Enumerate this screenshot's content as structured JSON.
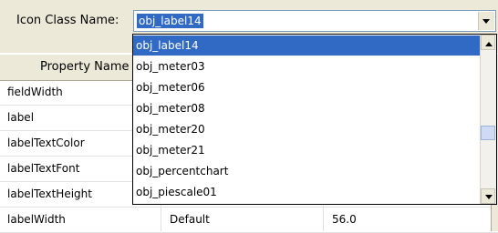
{
  "header": {
    "icon_class_label": "Icon Class Name:",
    "icon_class_value": "obj_label14"
  },
  "dropdown": {
    "items": [
      "obj_label14",
      "obj_meter03",
      "obj_meter06",
      "obj_meter08",
      "obj_meter20",
      "obj_meter21",
      "obj_percentchart",
      "obj_piescale01"
    ],
    "selected": "obj_label14"
  },
  "table": {
    "column_header": "Property Name",
    "rows": [
      {
        "name": "fieldWidth",
        "source": "",
        "value": ""
      },
      {
        "name": "label",
        "source": "",
        "value": ""
      },
      {
        "name": "labelTextColor",
        "source": "",
        "value": ""
      },
      {
        "name": "labelTextFont",
        "source": "",
        "value": ""
      },
      {
        "name": "labelTextHeight",
        "source": "",
        "value": ""
      },
      {
        "name": "labelWidth",
        "source": "Default",
        "value": "56.0"
      }
    ]
  },
  "colors": {
    "selection": "#316ac5",
    "panel": "#ece9d8"
  }
}
